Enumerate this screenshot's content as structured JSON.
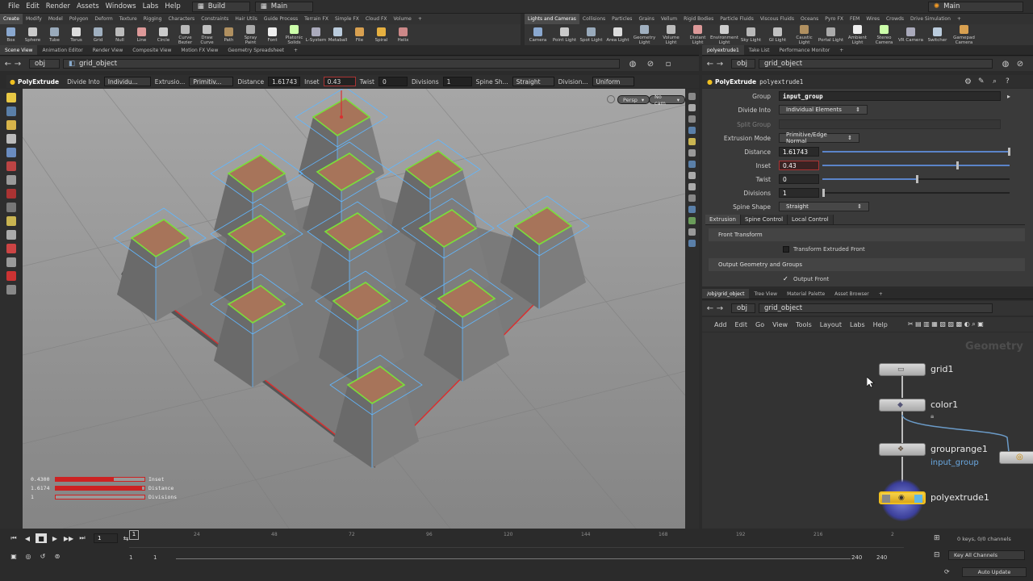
{
  "menu": [
    "File",
    "Edit",
    "Render",
    "Assets",
    "Windows",
    "Labs",
    "Help"
  ],
  "desktop": "Build",
  "desktop2": "Main",
  "title": "Main",
  "shelf_tabs_left": [
    "Create",
    "Modify",
    "Model",
    "Polygon",
    "Deform",
    "Texture",
    "Rigging",
    "Characters",
    "Constraints",
    "Hair Utils",
    "Guide Process",
    "Terrain FX",
    "Simple FX",
    "Cloud FX",
    "Volume"
  ],
  "shelf_tabs_right": [
    "Lights and Cameras",
    "Collisions",
    "Particles",
    "Grains",
    "Vellum",
    "Rigid Bodies",
    "Particle Fluids",
    "Viscous Fluids",
    "Oceans",
    "Pyro FX",
    "FEM",
    "Wires",
    "Crowds",
    "Drive Simulation"
  ],
  "tools_left": [
    "Box",
    "Sphere",
    "Tube",
    "Torus",
    "Grid",
    "Null",
    "Line",
    "Circle",
    "Curve Bezier",
    "Draw Curve",
    "Path",
    "Spray Paint",
    "Font",
    "Platonic Solids",
    "L-System",
    "Metaball",
    "File",
    "Spiral",
    "Helix"
  ],
  "tools_right": [
    "Camera",
    "Point Light",
    "Spot Light",
    "Area Light",
    "Geometry Light",
    "Volume Light",
    "Distant Light",
    "Environment Light",
    "Sky Light",
    "GI Light",
    "Caustic Light",
    "Portal Light",
    "Ambient Light",
    "Stereo Camera",
    "VR Camera",
    "Switcher",
    "Gamepad Camera"
  ],
  "viewer_tabs": [
    "Scene View",
    "Animation Editor",
    "Render View",
    "Composite View",
    "Motion FX View",
    "Geometry Spreadsheet"
  ],
  "path": {
    "context": "obj",
    "object": "grid_object"
  },
  "opbar": {
    "node": "PolyExtrude",
    "divide_into_label": "Divide Into",
    "divide_into": "Individu...",
    "extrusion_label": "Extrusio...",
    "extrusion": "Primitiv...",
    "distance_label": "Distance",
    "distance": "1.61743",
    "inset_label": "Inset",
    "inset": "0.43",
    "twist_label": "Twist",
    "twist": "0",
    "divisions_label": "Divisions",
    "divisions": "1",
    "spine_label": "Spine Sh...",
    "spine": "Straight",
    "division2_label": "Division...",
    "division2": "Uniform"
  },
  "viewport": {
    "persp": "Persp",
    "cam": "No cam"
  },
  "hud": [
    {
      "value": "0.4300",
      "label": "Inset",
      "frac": 0.65
    },
    {
      "value": "1.6174",
      "label": "Distance",
      "frac": 0.97
    },
    {
      "value": "1",
      "label": "Divisions",
      "frac": 0.0
    }
  ],
  "right_tabs": [
    "polyextrude1",
    "Take List",
    "Performance Monitor"
  ],
  "params": {
    "node_type": "PolyExtrude",
    "node_name": "polyextrude1",
    "group_label": "Group",
    "group": "input_group",
    "divide_into_label": "Divide Into",
    "divide_into": "Individual Elements",
    "split_group_label": "Split Group",
    "extrusion_mode_label": "Extrusion Mode",
    "extrusion_mode": "Primitive/Edge Normal",
    "distance_label": "Distance",
    "distance": "1.61743",
    "inset_label": "Inset",
    "inset": "0.43",
    "twist_label": "Twist",
    "twist": "0",
    "divisions_label": "Divisions",
    "divisions": "1",
    "spine_label": "Spine Shape",
    "spine": "Straight",
    "subtabs": [
      "Extrusion",
      "Spine Control",
      "Local Control"
    ],
    "front_transform": "Front Transform",
    "transform_front": "Transform Extruded Front",
    "output_groups": "Output Geometry and Groups",
    "output_front": "Output Front"
  },
  "network_tabs": [
    "/obj/grid_object",
    "Tree View",
    "Material Palette",
    "Asset Browser"
  ],
  "network_menu": [
    "Add",
    "Edit",
    "Go",
    "View",
    "Tools",
    "Layout",
    "Labs",
    "Help"
  ],
  "network_context": "Geometry",
  "nodes": [
    {
      "name": "grid1",
      "sub": ""
    },
    {
      "name": "color1",
      "sub": ""
    },
    {
      "name": "grouprange1",
      "sub": "input_group"
    },
    {
      "name": "polyextrude1",
      "sub": ""
    }
  ],
  "timeline": {
    "ticks": [
      "1",
      "24",
      "48",
      "72",
      "96",
      "120",
      "144",
      "168",
      "192",
      "216",
      "2"
    ],
    "frame": "1",
    "start": "1",
    "start2": "1",
    "end": "240",
    "end2": "240",
    "keys": "0 keys, 0/0 channels",
    "key_all": "Key All Channels",
    "auto_update": "Auto Update"
  },
  "colors": {
    "accent": "#f0c020",
    "selection_green": "#7adf3a",
    "top_face": "#a7745a",
    "guide_blue": "#61b7ff",
    "edge_red": "#d83030"
  }
}
